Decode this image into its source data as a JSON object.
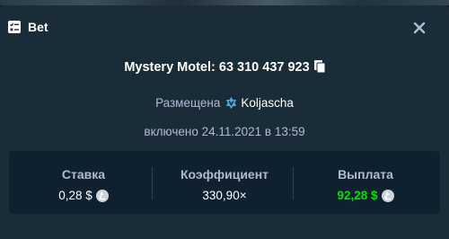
{
  "modal": {
    "title": "Bet",
    "header_icon": "bet-slip-icon",
    "close_icon": "close-icon"
  },
  "game": {
    "name_id": "Mystery Motel: 63 310 437 923",
    "copy_icon": "copy-icon"
  },
  "placed": {
    "label": "Размещена",
    "user_icon": "vip-badge-icon",
    "username": "Koljascha"
  },
  "date": {
    "text": "включено 24.11.2021 в 13:59"
  },
  "stats": {
    "bet": {
      "label": "Ставка",
      "value": "0,28 $",
      "icon": "litecoin-icon"
    },
    "multiplier": {
      "label": "Коэффициент",
      "value": "330,90×"
    },
    "payout": {
      "label": "Выплата",
      "value": "92,28 $",
      "icon": "litecoin-icon",
      "color": "#00e701"
    }
  },
  "colors": {
    "modal_bg": "#1a2c38",
    "stats_bg": "#0f212e",
    "muted_text": "#b1bad3",
    "win_green": "#00e701"
  }
}
